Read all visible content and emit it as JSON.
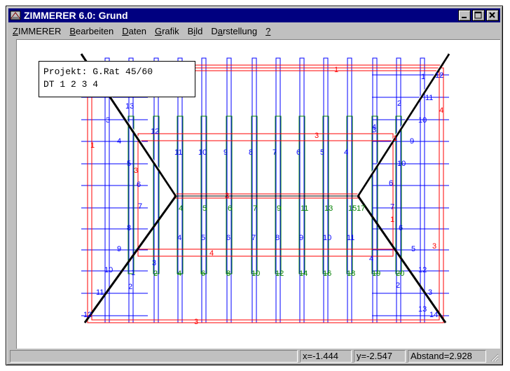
{
  "window": {
    "title": "ZIMMERER 6.0: Grund",
    "minimize_label": "_",
    "maximize_label": "□",
    "close_label": "×"
  },
  "menu": [
    {
      "label": "ZIMMERER",
      "underline": "Z"
    },
    {
      "label": "Bearbeiten",
      "underline": "B"
    },
    {
      "label": "Daten",
      "underline": "D"
    },
    {
      "label": "Grafik",
      "underline": "G"
    },
    {
      "label": "Bild",
      "underline": "i"
    },
    {
      "label": "Darstellung",
      "underline": "a"
    },
    {
      "label": "?",
      "underline": "?"
    }
  ],
  "info_box": {
    "line1": "Projekt: G.Rat 45/60",
    "line2": "DT 1 2 3 4"
  },
  "status": {
    "message": "",
    "x": "x=-1.444",
    "y": "y=-2.547",
    "distance": "Abstand=2.928"
  },
  "drawing": {
    "colors": {
      "red": "#ff0000",
      "blue": "#0000ff",
      "green": "#008000",
      "black": "#000000"
    },
    "blue_top_rafter_labels": [
      "11",
      "10",
      "9",
      "8",
      "7",
      "6",
      "5",
      "4"
    ],
    "blue_bottom_rafter_labels": [
      "4",
      "5",
      "6",
      "7",
      "8",
      "9",
      "10",
      "11"
    ],
    "green_middle_labels": [
      "4",
      "5",
      "6",
      "7",
      "9",
      "11",
      "13",
      "15",
      "17"
    ],
    "green_bottom_labels": [
      "2",
      "4",
      "6",
      "8",
      "10",
      "12",
      "14",
      "16",
      "18",
      "19",
      "20"
    ],
    "left_labels": [
      "13",
      "3",
      "4",
      "5",
      "6",
      "7",
      "8",
      "9",
      "10",
      "11",
      "12",
      "1",
      "2",
      "3",
      "12"
    ],
    "right_labels": [
      "1",
      "12",
      "11",
      "2",
      "10",
      "3",
      "9",
      "10",
      "6",
      "7",
      "6",
      "5",
      "4",
      "12",
      "3",
      "2",
      "13",
      "14",
      "4"
    ],
    "red_labels": [
      "1",
      "1",
      "3",
      "3",
      "3",
      "4",
      "3",
      "1",
      "3",
      "4",
      "1"
    ]
  }
}
